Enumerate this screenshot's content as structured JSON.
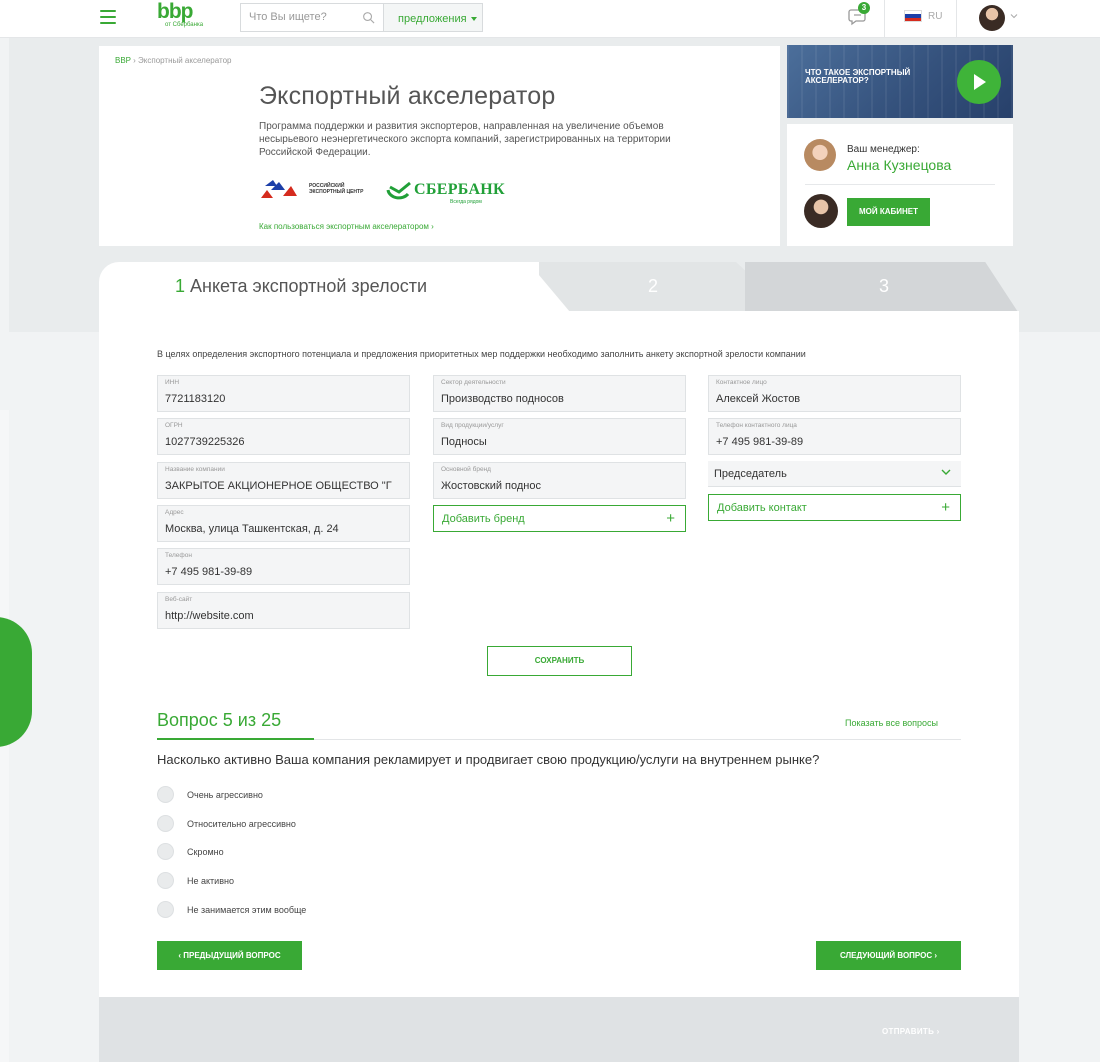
{
  "header": {
    "logo": "bbp",
    "logo_sub": "от Сбербанка",
    "search_placeholder": "Что Вы ищете?",
    "offers_label": "предложения",
    "chat_badge": "3",
    "lang": "RU",
    "accent": "#39a935"
  },
  "hero": {
    "breadcrumb_home": "BBP",
    "breadcrumb_sep": "›",
    "breadcrumb_current": "Экспортный акселератор",
    "title": "Экспортный акселератор",
    "description": "Программа поддержки и развития экспортеров, направленная на увеличение объемов несырьевого неэнергетического экспорта компаний, зарегистрированных на территории Российской Федерации.",
    "partner1": "Российский экспортный центр",
    "partner2": "СБЕРБАНК",
    "partner2_slogan": "Всегда рядом",
    "how_to_link": "Как пользоваться экспортным акселератором ›"
  },
  "video": {
    "title": "Что такое экспортный акселератор?"
  },
  "manager": {
    "label": "Ваш менеджер:",
    "name": "Анна Кузнецова",
    "cabinet_button": "МОЙ КАБИНЕТ"
  },
  "tabs": [
    {
      "num": "1",
      "label": "Анкета экспортной зрелости"
    },
    {
      "num": "2",
      "label": ""
    },
    {
      "num": "3",
      "label": ""
    }
  ],
  "form": {
    "intro": "В целях определения экспортного потенциала и предложения приоритетных мер поддержки необходимо заполнить анкету экспортной зрелости компании",
    "col1": [
      {
        "label": "ИНН",
        "value": "7721183120"
      },
      {
        "label": "ОГРН",
        "value": "1027739225326"
      },
      {
        "label": "Название компании",
        "value": "ЗАКРЫТОЕ АКЦИОНЕРНОЕ ОБЩЕСТВО \"Г"
      },
      {
        "label": "Адрес",
        "value": "Москва, улица Ташкентская, д. 24"
      },
      {
        "label": "Телефон",
        "value": "+7 495 981-39-89"
      },
      {
        "label": "Веб-сайт",
        "value": "http://website.com"
      }
    ],
    "col2": [
      {
        "label": "Сектор деятельности",
        "value": "Производство подносов"
      },
      {
        "label": "Вид продукции/услуг",
        "value": "Подносы"
      },
      {
        "label": "Основной бренд",
        "value": "Жостовский поднос"
      }
    ],
    "add_brand": "Добавить бренд",
    "col3": [
      {
        "label": "Контактное лицо",
        "value": "Алексей Жостов"
      },
      {
        "label": "Телефон контактного лица",
        "value": "+7 495 981-39-89"
      }
    ],
    "position_select": "Председатель",
    "add_contact": "Добавить контакт",
    "save_button": "СОХРАНИТЬ"
  },
  "quiz": {
    "title": "Вопрос 5 из 25",
    "show_all": "Показать все вопросы",
    "question": "Насколько активно Ваша компания рекламирует и продвигает свою продукцию/услуги на внутреннем рынке?",
    "options": [
      "Очень агрессивно",
      "Относительно агрессивно",
      "Скромно",
      "Не активно",
      "Не занимается этим вообще"
    ],
    "prev_button": "‹ ПРЕДЫДУЩИЙ ВОПРОС",
    "next_button": "СЛЕДУЮЩИЙ ВОПРОС ›",
    "submit": "ОТПРАВИТЬ ›"
  }
}
